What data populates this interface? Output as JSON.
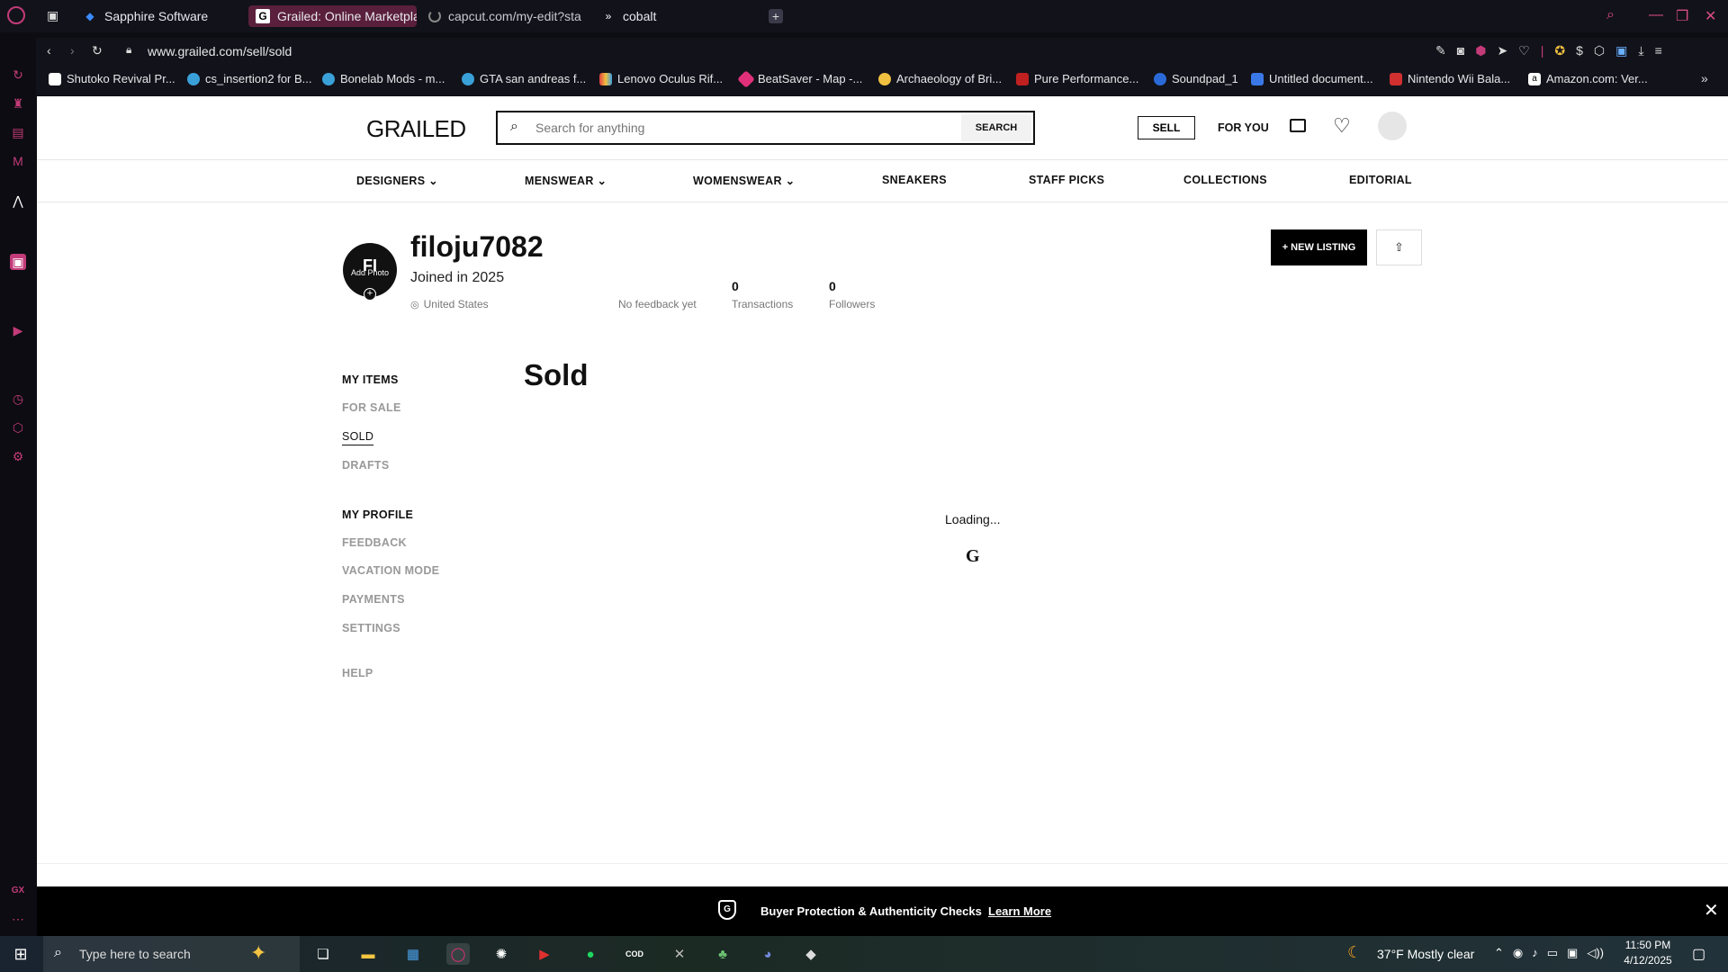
{
  "browser": {
    "tabs": [
      {
        "title": "Sapphire Software",
        "icon": "diamond-icon",
        "active": false
      },
      {
        "title": "Grailed: Online Marketplac",
        "icon": "grailed-g-icon",
        "active": true
      },
      {
        "title": "capcut.com/my-edit?start",
        "icon": "loading-spinner-icon",
        "active": false
      },
      {
        "title": "cobalt",
        "icon": "chevrons-icon",
        "active": false
      }
    ],
    "url": "www.grailed.com/sell/sold",
    "bookmarks": [
      {
        "label": "Shutoko Revival Pr...",
        "color": "#ffffff"
      },
      {
        "label": "cs_insertion2 for B...",
        "color": "#3aa0d8"
      },
      {
        "label": "Bonelab Mods - m...",
        "color": "#3aa0d8"
      },
      {
        "label": "GTA san andreas f...",
        "color": "#3aa0d8"
      },
      {
        "label": "Lenovo Oculus Rif...",
        "color": "#e04040"
      },
      {
        "label": "BeatSaver - Map -...",
        "color": "#e0307a"
      },
      {
        "label": "Archaeology of Bri...",
        "color": "#f0c040"
      },
      {
        "label": "Pure Performance...",
        "color": "#c02020"
      },
      {
        "label": "Soundpad_1",
        "color": "#2a6ad8"
      },
      {
        "label": "Untitled document...",
        "color": "#3b78e7"
      },
      {
        "label": "Nintendo Wii Bala...",
        "color": "#d03030"
      },
      {
        "label": "Amazon.com: Ver...",
        "color": "#ffffff"
      }
    ]
  },
  "header": {
    "logo": "GRAILED",
    "search_placeholder": "Search for anything",
    "search_button": "SEARCH",
    "sell": "SELL",
    "for_you": "FOR YOU"
  },
  "nav": {
    "designers": "DESIGNERS",
    "menswear": "MENSWEAR",
    "womenswear": "WOMENSWEAR",
    "sneakers": "SNEAKERS",
    "staff_picks": "STAFF PICKS",
    "collections": "COLLECTIONS",
    "editorial": "EDITORIAL"
  },
  "profile": {
    "initials": "FI",
    "add_photo": "Add Photo",
    "username": "filoju7082",
    "joined": "Joined in 2025",
    "location": "United States",
    "feedback": "No feedback yet",
    "transactions_count": "0",
    "transactions_label": "Transactions",
    "followers_count": "0",
    "followers_label": "Followers",
    "new_listing": "+ NEW LISTING"
  },
  "sidebar_menu": {
    "my_items": "MY ITEMS",
    "for_sale": "FOR SALE",
    "sold": "SOLD",
    "drafts": "DRAFTS",
    "my_profile": "MY PROFILE",
    "feedback": "FEEDBACK",
    "vacation_mode": "VACATION MODE",
    "payments": "PAYMENTS",
    "settings": "SETTINGS",
    "help": "HELP"
  },
  "main": {
    "title": "Sold",
    "loading": "Loading...",
    "loading_glyph": "G"
  },
  "banner": {
    "text": "Buyer Protection & Authenticity Checks",
    "link": "Learn More"
  },
  "taskbar": {
    "search_placeholder": "Type here to search",
    "weather": "37°F  Mostly clear",
    "time": "11:50 PM",
    "date": "4/12/2025"
  }
}
